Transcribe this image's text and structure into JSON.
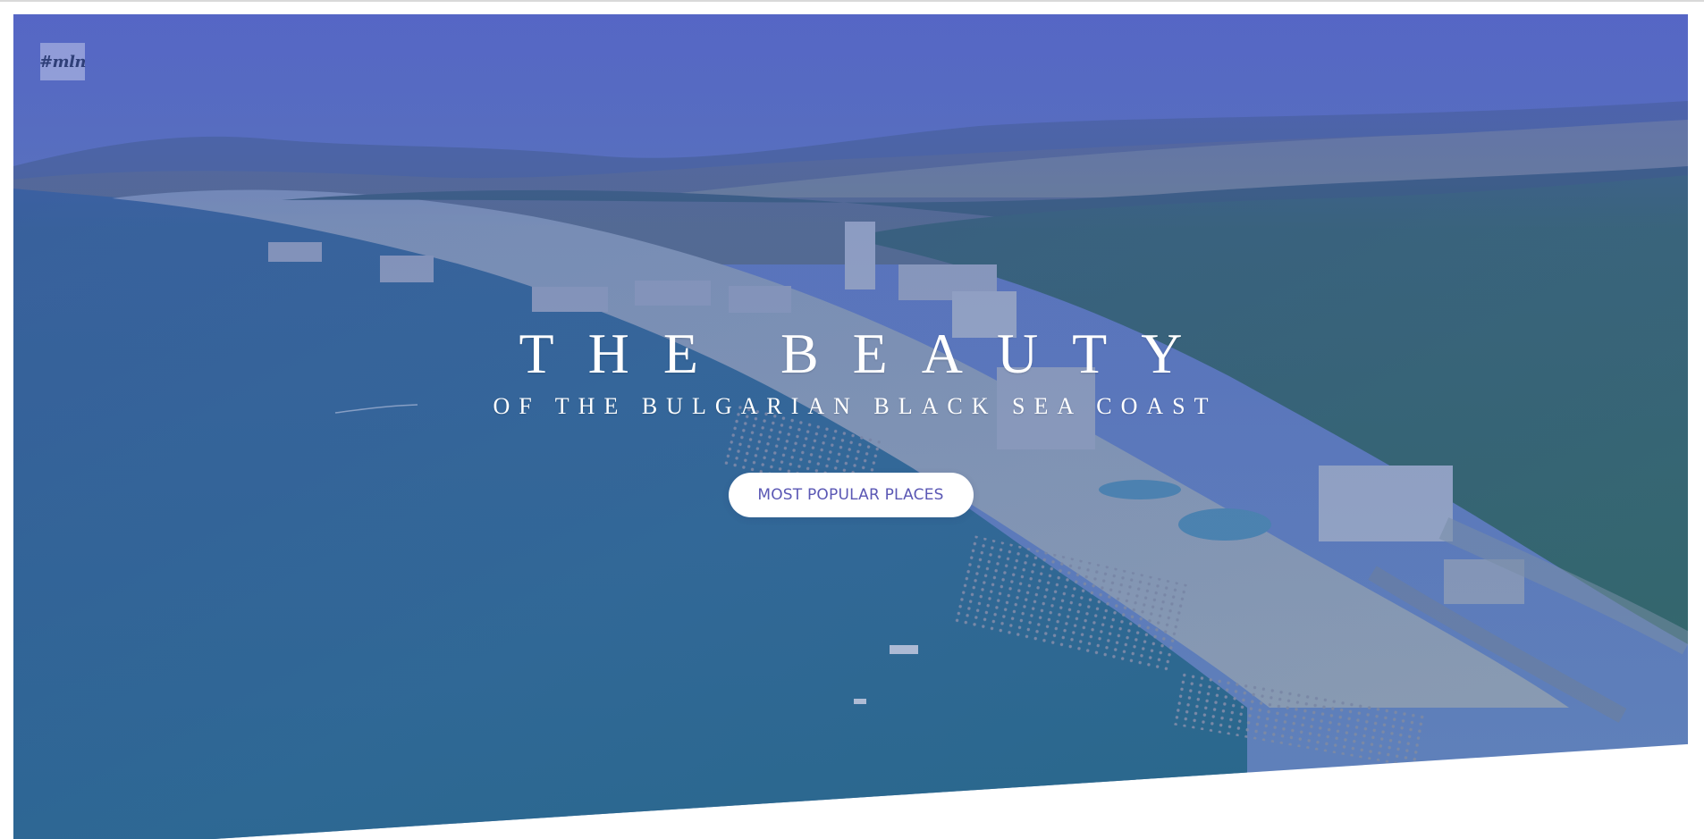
{
  "header": {
    "logo_text": "#mln"
  },
  "hero": {
    "headline": "THE BEAUTY",
    "subheadline": "OF THE BULGARIAN BLACK SEA COAST",
    "cta_label": "MOST POPULAR PLACES"
  },
  "colors": {
    "overlay": "#5A67C4",
    "button_text": "#5A57B4",
    "sea": "#2E6D92",
    "forest": "#2E6C5A"
  }
}
